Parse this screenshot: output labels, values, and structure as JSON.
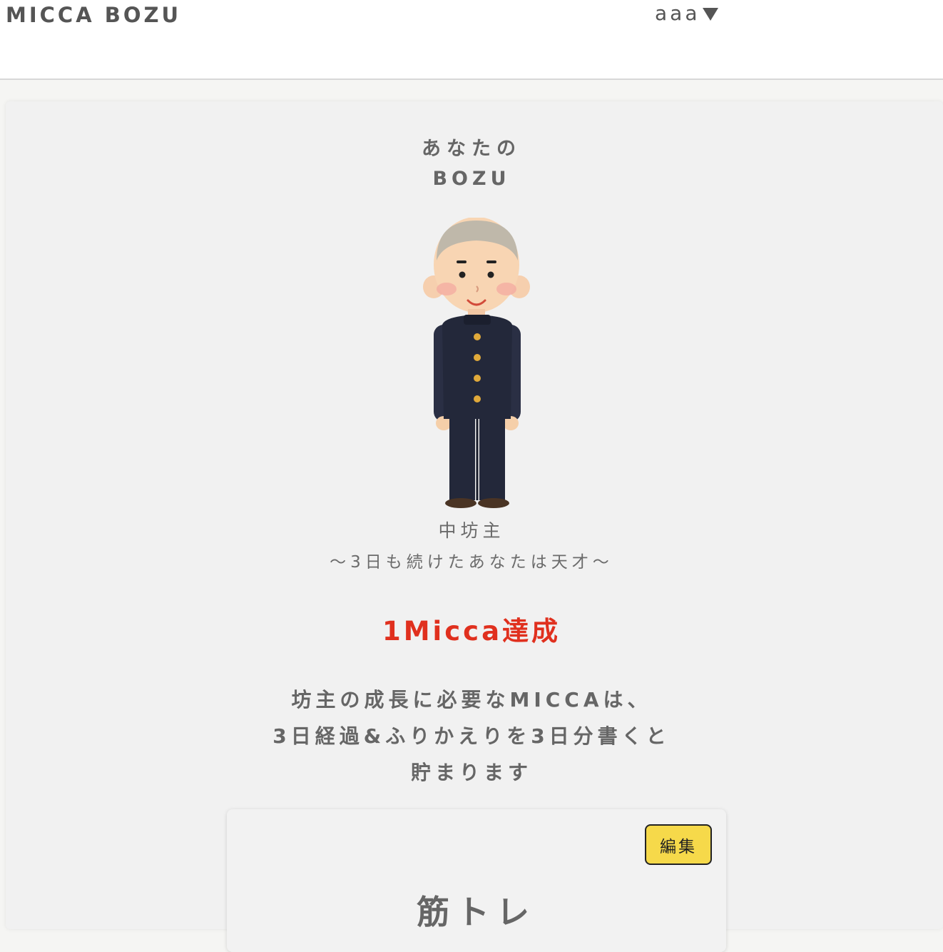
{
  "header": {
    "brand": "MICCA BOZU",
    "user_name": "aaa"
  },
  "bozu": {
    "heading_line1": "あなたの",
    "heading_line2": "BOZU",
    "rank_name": "中坊主",
    "rank_description": "〜3日も続けたあなたは天才〜",
    "achievement": "1Micca達成",
    "explanation_lines": [
      "坊主の成長に必要なMICCAは、",
      "3日経過&ふりかえりを3日分書くと",
      "貯まります"
    ]
  },
  "habit": {
    "edit_label": "編集",
    "title": "筋トレ"
  },
  "colors": {
    "accent_red": "#e0301e",
    "edit_button_yellow": "#f6d94a",
    "uniform_navy": "#23283a"
  },
  "icons": {
    "user_menu_caret": "caret-down-icon",
    "character": "bozu-character-illustration"
  }
}
